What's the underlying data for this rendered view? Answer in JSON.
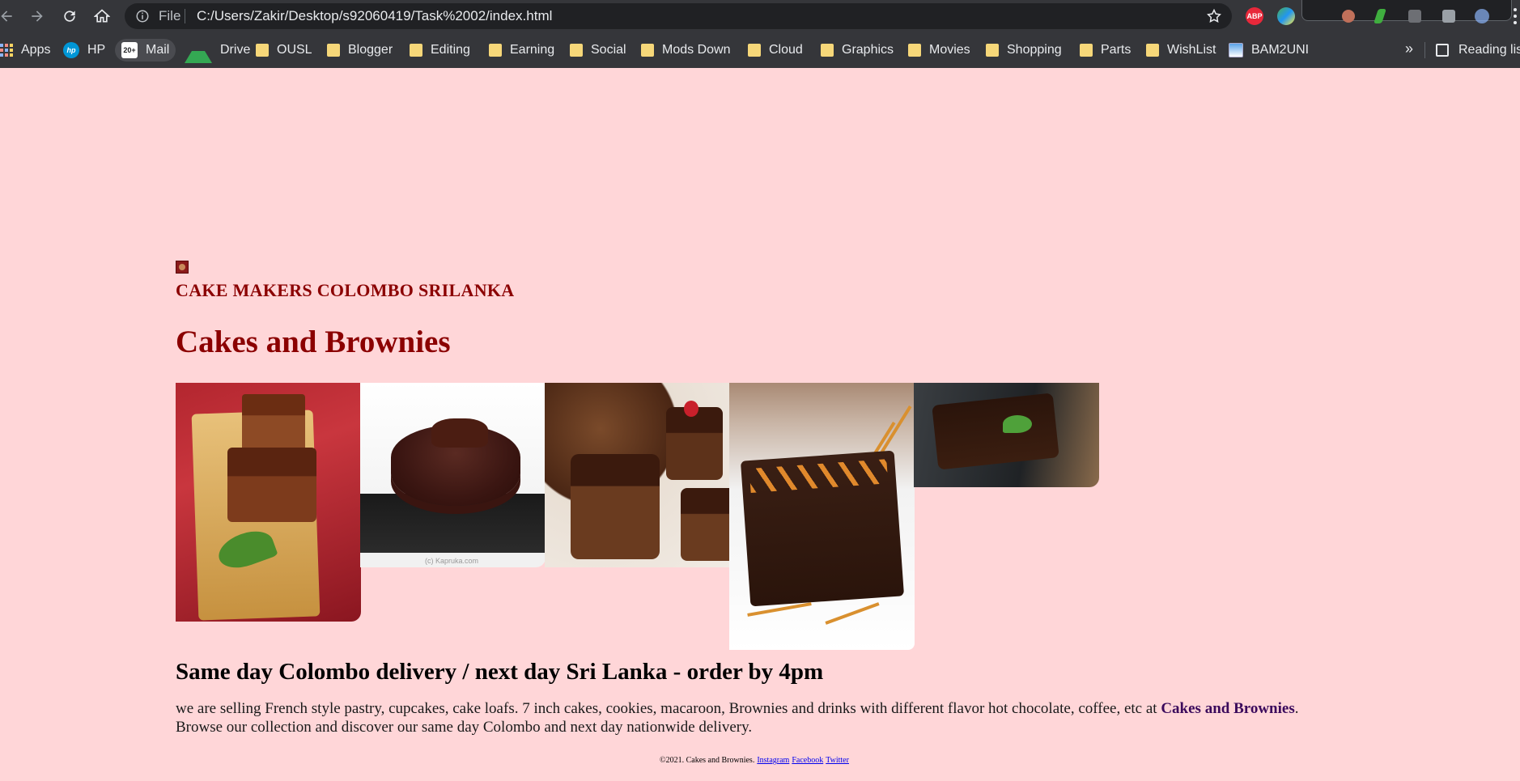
{
  "browser": {
    "file_label": "File",
    "url": "C:/Users/Zakir/Desktop/s92060419/Task%2002/index.html",
    "abp_label": "ABP",
    "bookmarks": [
      {
        "label": "Apps",
        "icon": "apps-grid-icon"
      },
      {
        "label": "HP",
        "icon": "hp-logo-icon"
      },
      {
        "label": "Mail",
        "icon": "mail-icon",
        "badge": "20+"
      },
      {
        "label": "Drive",
        "icon": "drive-icon"
      },
      {
        "label": "OUSL",
        "icon": "folder-icon"
      },
      {
        "label": "Blogger",
        "icon": "folder-icon"
      },
      {
        "label": "Editing",
        "icon": "folder-icon"
      },
      {
        "label": "Earning",
        "icon": "folder-icon"
      },
      {
        "label": "Social",
        "icon": "folder-icon"
      },
      {
        "label": "Mods Down",
        "icon": "folder-icon"
      },
      {
        "label": "Cloud",
        "icon": "folder-icon"
      },
      {
        "label": "Graphics",
        "icon": "folder-icon"
      },
      {
        "label": "Movies",
        "icon": "folder-icon"
      },
      {
        "label": "Shopping",
        "icon": "folder-icon"
      },
      {
        "label": "Parts",
        "icon": "folder-icon"
      },
      {
        "label": "WishList",
        "icon": "folder-icon"
      },
      {
        "label": "BAM2UNI",
        "icon": "site-icon"
      }
    ],
    "overflow_label": "»",
    "reading_list_label": "Reading list"
  },
  "page": {
    "brand": "CAKE MAKERS COLOMBO SRILANKA",
    "title": "Cakes and Brownies",
    "gallery": [
      {
        "name": "chocolate-cake-slices-photo"
      },
      {
        "name": "chocolate-round-cake-photo",
        "watermark": "(c) Kapruka.com"
      },
      {
        "name": "frosted-brownie-bites-photo"
      },
      {
        "name": "pretzel-brownie-photo"
      },
      {
        "name": "mint-brownies-photo"
      }
    ],
    "delivery_heading": "Same day Colombo delivery / next day Sri Lanka - order by 4pm",
    "description_before": "we are selling French style pastry, cupcakes, cake loafs. 7 inch cakes, cookies, macaroon, Brownies and drinks with different flavor hot chocolate, coffee, etc at ",
    "description_link": "Cakes and Brownies",
    "description_after": ". Browse our collection and discover our same day Colombo and next day nationwide delivery.",
    "footer_text": "©2021. Cakes and Brownies.",
    "footer_links": [
      "Instagram",
      "Facebook",
      "Twitter"
    ]
  },
  "colors": {
    "page_background": "#ffd6d8",
    "heading_red": "#8b0000",
    "browser_chrome": "#35363a"
  }
}
